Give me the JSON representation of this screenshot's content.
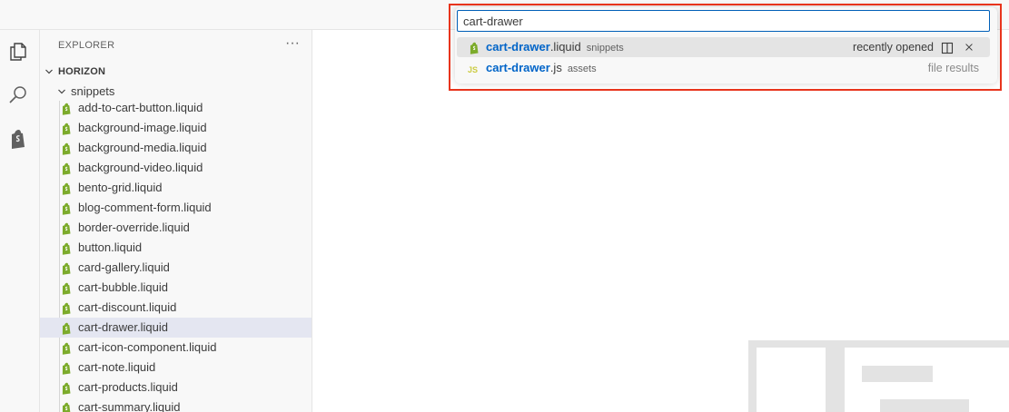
{
  "sidebar": {
    "title": "EXPLORER",
    "more_icon": "ellipsis-icon",
    "project": "HORIZON",
    "folder": "snippets",
    "files": [
      "add-to-cart-button.liquid",
      "background-image.liquid",
      "background-media.liquid",
      "background-video.liquid",
      "bento-grid.liquid",
      "blog-comment-form.liquid",
      "border-override.liquid",
      "button.liquid",
      "card-gallery.liquid",
      "cart-bubble.liquid",
      "cart-discount.liquid",
      "cart-drawer.liquid",
      "cart-icon-component.liquid",
      "cart-note.liquid",
      "cart-products.liquid",
      "cart-summary.liquid"
    ],
    "selected_file": "cart-drawer.liquid"
  },
  "activity_bar": {
    "icons": [
      "explorer-icon",
      "search-icon",
      "shopify-icon"
    ]
  },
  "quick_open": {
    "input_value": "cart-drawer",
    "results": [
      {
        "match": "cart-drawer",
        "suffix": ".liquid",
        "description": "snippets",
        "right_label": "recently opened",
        "icon": "shopify-liquid-icon",
        "active": true
      },
      {
        "match": "cart-drawer",
        "suffix": ".js",
        "description": "assets",
        "right_label": "file results",
        "icon": "javascript-icon",
        "active": false
      }
    ]
  },
  "colors": {
    "accent": "#005fb8",
    "highlight_text": "#0064c8",
    "annotation_border": "#e8341c",
    "liquid_icon": "#7cab2b",
    "js_icon": "#cbcb41"
  }
}
